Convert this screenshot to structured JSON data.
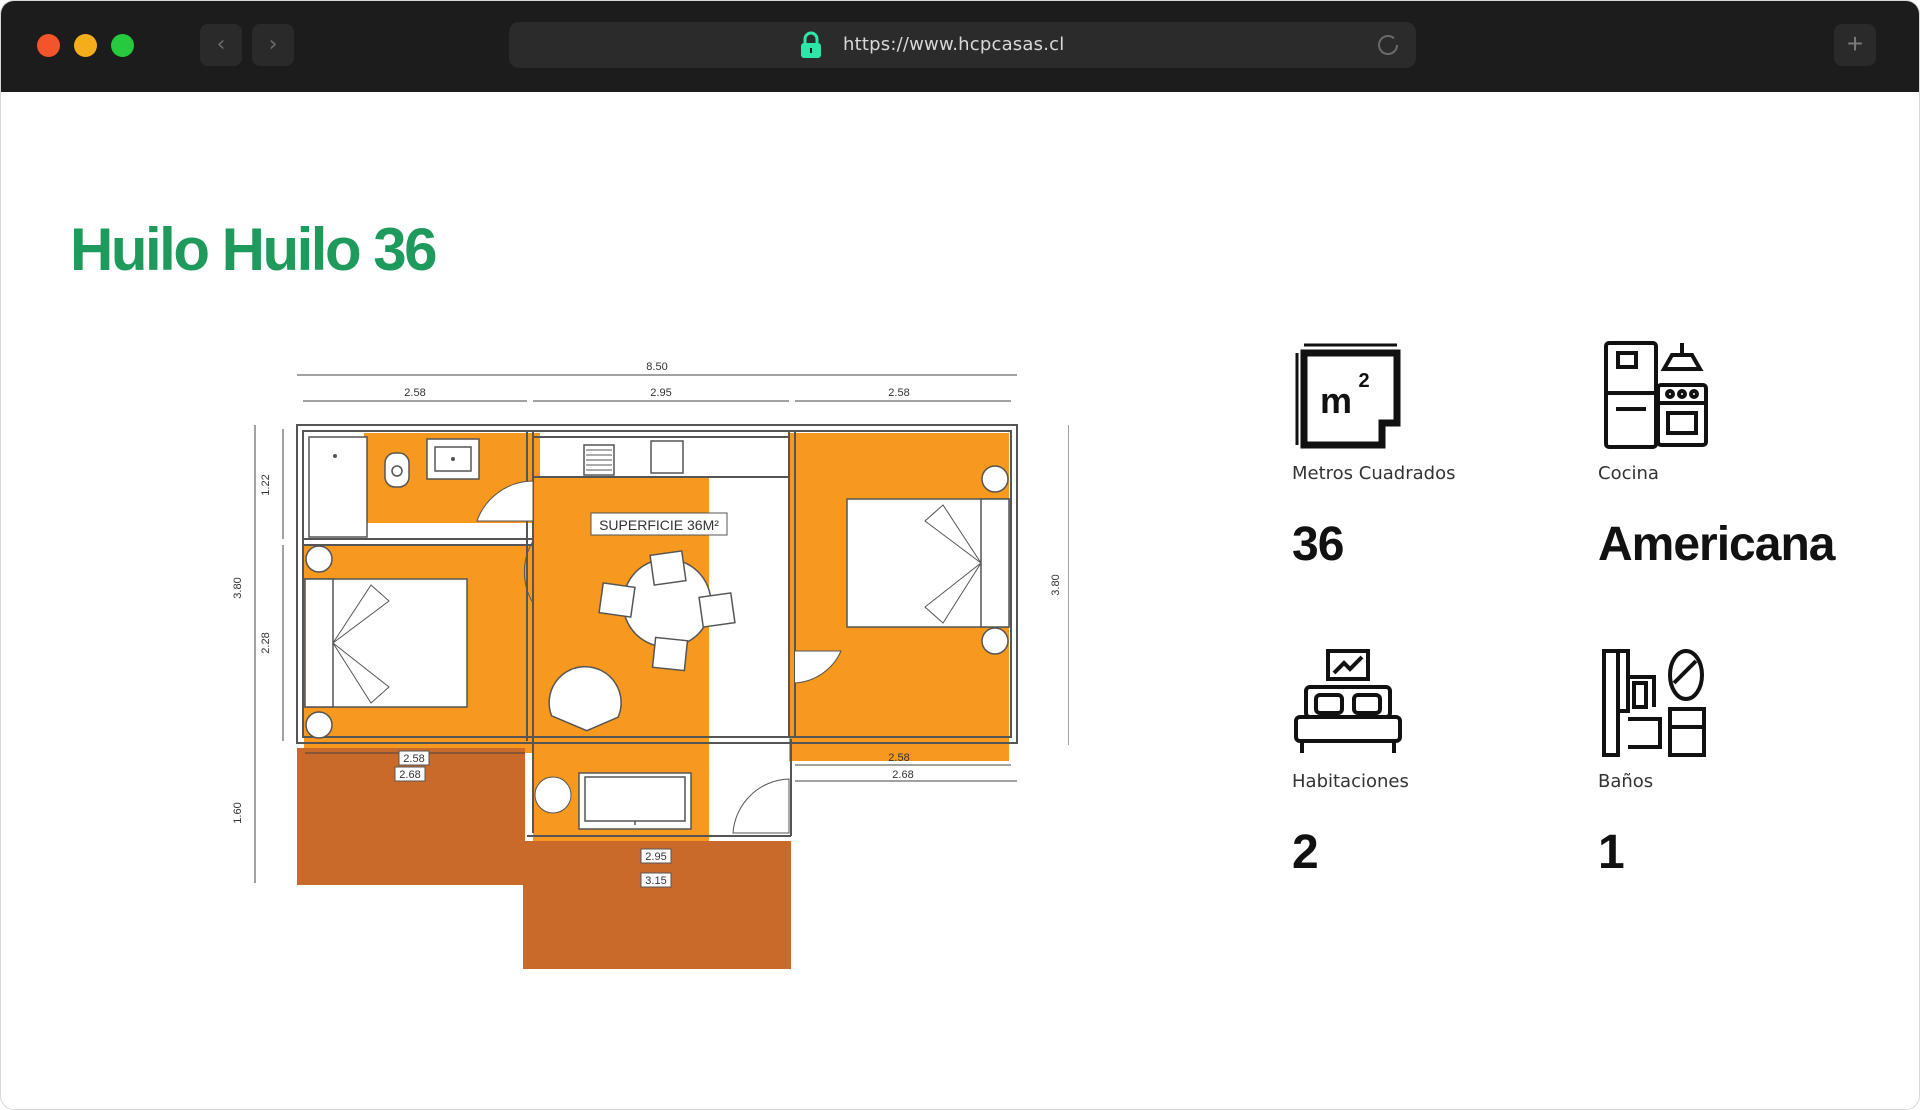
{
  "browser": {
    "url": "https://www.hcpcasas.cl",
    "back_icon": "chevron-left-icon",
    "forward_icon": "chevron-right-icon",
    "new_tab_icon": "plus-icon"
  },
  "page": {
    "title": "Huilo Huilo 36",
    "title_color": "#1f9a5d"
  },
  "floorplan": {
    "surface_label": "SUPERFICIE 36M²",
    "dimensions": {
      "total_width": "8.50",
      "left_width": "2.58",
      "center_width": "2.95",
      "right_width": "2.58",
      "left_height": "3.80",
      "right_height": "3.80",
      "bath_height": "1.22",
      "bedroom_height": "2.28",
      "terrace_height": "1.60",
      "left_inner_a": "2.58",
      "left_inner_b": "2.68",
      "right_inner_a": "2.58",
      "right_inner_b": "2.68",
      "center_inner_a": "2.95",
      "center_inner_b": "3.15"
    },
    "colors": {
      "rooms": "#f7981f",
      "terrace": "#c9692a",
      "walls": "#555555"
    }
  },
  "features": [
    {
      "icon": "square-meters-icon",
      "label": "Metros Cuadrados",
      "value": "36"
    },
    {
      "icon": "kitchen-icon",
      "label": "Cocina",
      "value": "Americana"
    },
    {
      "icon": "bed-icon",
      "label": "Habitaciones",
      "value": "2"
    },
    {
      "icon": "bathroom-icon",
      "label": "Baños",
      "value": "1"
    }
  ]
}
